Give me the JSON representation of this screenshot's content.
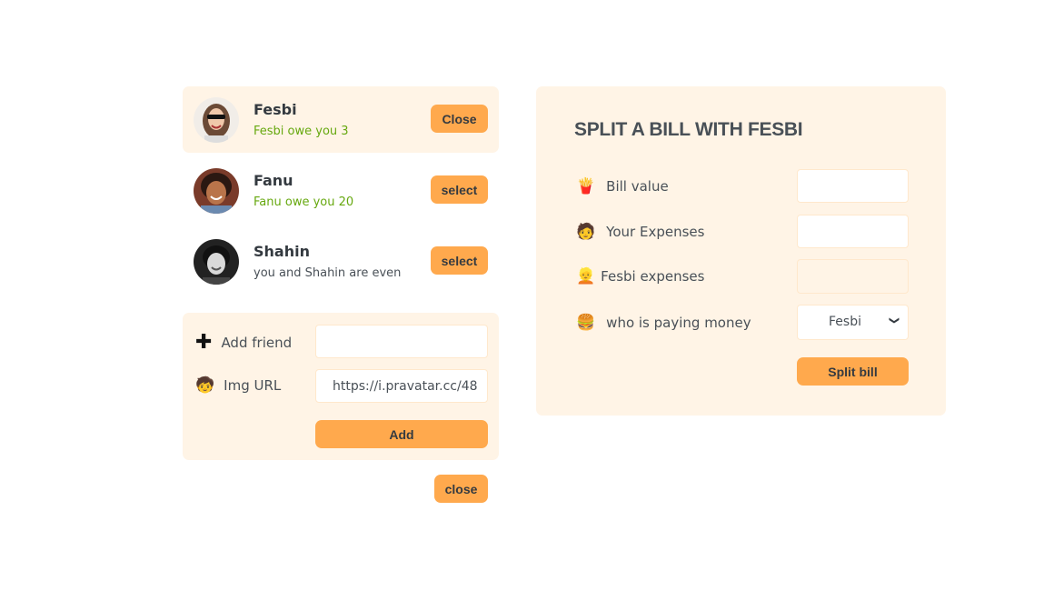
{
  "friends": [
    {
      "name": "Fesbi",
      "status": "Fesbi owe you 3",
      "button": "Close"
    },
    {
      "name": "Fanu",
      "status": "Fanu owe you 20",
      "button": "select"
    },
    {
      "name": "Shahin",
      "status": "you and Shahin are even",
      "button": "select"
    }
  ],
  "add_form": {
    "name_label": "Add friend",
    "name_value": "",
    "img_label": "Img URL",
    "img_value": "https://i.pravatar.cc/48",
    "submit": "Add",
    "name_icon": "✚",
    "img_icon": "🧒"
  },
  "close_button": "close",
  "split": {
    "title": "SPLIT A BILL WITH FESBI",
    "bill_label": "Bill value",
    "bill_icon": "🍟",
    "bill_value": "",
    "your_label": "Your Expenses",
    "your_icon": "🧑",
    "your_value": "",
    "friend_label": "Fesbi expenses",
    "friend_icon": "👱",
    "friend_value": "",
    "payer_label": "who is paying money",
    "payer_icon": "🍔",
    "payer_selected": "Fesbi",
    "submit": "Split bill"
  },
  "colors": {
    "accent": "#ffa94d",
    "panel_bg": "#fff4e6",
    "positive": "#66a80f"
  }
}
